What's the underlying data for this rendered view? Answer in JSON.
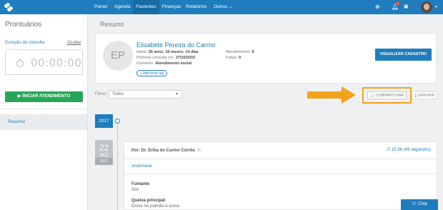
{
  "nav": {
    "items": [
      {
        "label": "Painel"
      },
      {
        "label": "Agenda"
      },
      {
        "label": "Pacientes"
      },
      {
        "label": "Finanças"
      },
      {
        "label": "Relatórios"
      },
      {
        "label": "Outros ⌄"
      }
    ],
    "active": "Pacientes",
    "notification_count": "1"
  },
  "sidebar": {
    "title": "Prontuários",
    "duration_label": "Duração da consulta",
    "hide_label": "Ocultar",
    "timer": "00:00:00",
    "start_button": "▶ INICIAR ATENDIMENTO",
    "resumo": "Resumo"
  },
  "main": {
    "title": "Resumo",
    "patient": {
      "initials": "EP",
      "name": "Elisabete Pereira do Carmo",
      "age_label": "Idade:",
      "age_value": "55 anos, 10 meses, 14 dias",
      "first_label": "Primeira consulta em:",
      "first_value": "27/10/2015",
      "conv_label": "Convênio:",
      "conv_value": "Atendimento social",
      "tag_button": "+ Adicionar tag",
      "attend_label": "Atendimentos:",
      "attend_value": "6",
      "faltas_label": "Faltas:",
      "faltas_value": "0",
      "view_button": "VISUALIZAR CADASTRO"
    },
    "filter": {
      "label": "Filtrar:",
      "value": "Todos"
    },
    "share_button": "COMPARTILHAR",
    "print_button": "IMPRIMIR"
  },
  "timeline": {
    "year": "2017",
    "date": {
      "day": "22",
      "month": "DEZ",
      "year": "2017"
    },
    "entry": {
      "by": "Por: Dr. Erika do Carmo Corrêa",
      "extra": "2h",
      "time": "15:38 (49 segundos)",
      "section": "Anamnese",
      "fields": [
        {
          "label": "Fumante",
          "value": "Sim"
        },
        {
          "label": "Queixa principal:",
          "value": "Dores no pulmão e tosse."
        }
      ]
    }
  },
  "chat_button": "Chat",
  "colors": {
    "primary": "#1f7dbd",
    "success": "#29a55a",
    "highlight": "#f2a21c"
  }
}
